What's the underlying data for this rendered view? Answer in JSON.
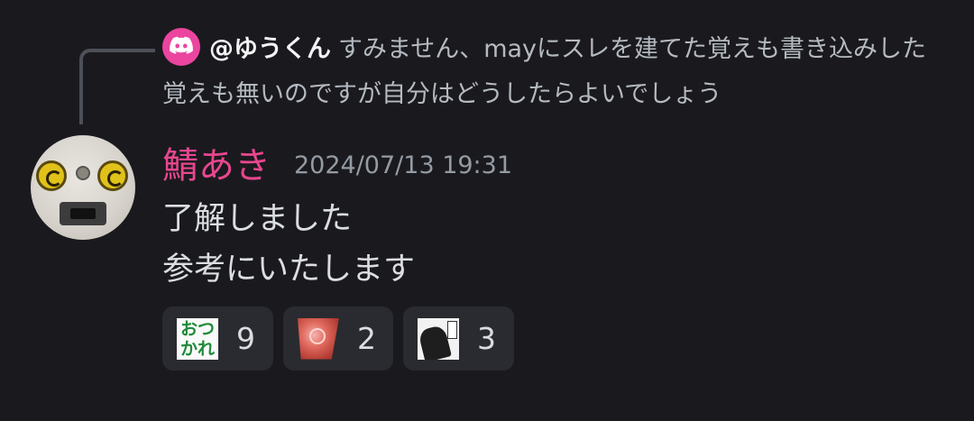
{
  "reply": {
    "username": "@ゆうくん",
    "text": "すみません、mayにスレを建てた覚えも書き込みした覚えも無いのですが自分はどうしたらよいでしょう",
    "avatar_icon": "discord-icon",
    "avatar_color": "#eb459f"
  },
  "message": {
    "author": "鯖あき",
    "author_color": "#e8478f",
    "timestamp": "2024/07/13 19:31",
    "lines": [
      "了解しました",
      "参考にいたします"
    ],
    "avatar_icon": "robot-face-avatar"
  },
  "reactions": [
    {
      "emoji": "otsukare-emoji",
      "emoji_text": [
        "おつ",
        "かれ"
      ],
      "count": "9"
    },
    {
      "emoji": "red-sparkle-emoji",
      "count": "2"
    },
    {
      "emoji": "manga-character-emoji",
      "count": "3"
    }
  ]
}
